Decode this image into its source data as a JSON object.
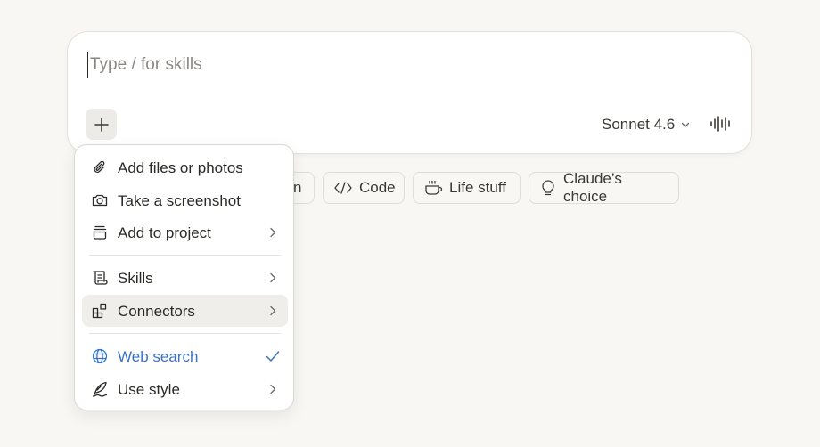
{
  "composer": {
    "placeholder": "Type / for skills",
    "model_label": "Sonnet 4.6"
  },
  "chips": [
    {
      "label": "n",
      "icon": "pen-icon"
    },
    {
      "label": "Code",
      "icon": "code-icon"
    },
    {
      "label": "Life stuff",
      "icon": "coffee-icon"
    },
    {
      "label": "Claude’s choice",
      "icon": "lightbulb-icon"
    }
  ],
  "menu": {
    "items": [
      {
        "label": "Add files or photos",
        "icon": "paperclip-icon"
      },
      {
        "label": "Take a screenshot",
        "icon": "camera-icon"
      },
      {
        "label": "Add to project",
        "icon": "box-icon",
        "submenu": true
      },
      {
        "label": "Skills",
        "icon": "scroll-icon",
        "submenu": true
      },
      {
        "label": "Connectors",
        "icon": "connectors-icon",
        "submenu": true
      },
      {
        "label": "Web search",
        "icon": "globe-icon",
        "checked": true
      },
      {
        "label": "Use style",
        "icon": "feather-icon",
        "submenu": true
      }
    ]
  },
  "colors": {
    "accent": "#3b72c4",
    "background": "#f8f7f4"
  }
}
